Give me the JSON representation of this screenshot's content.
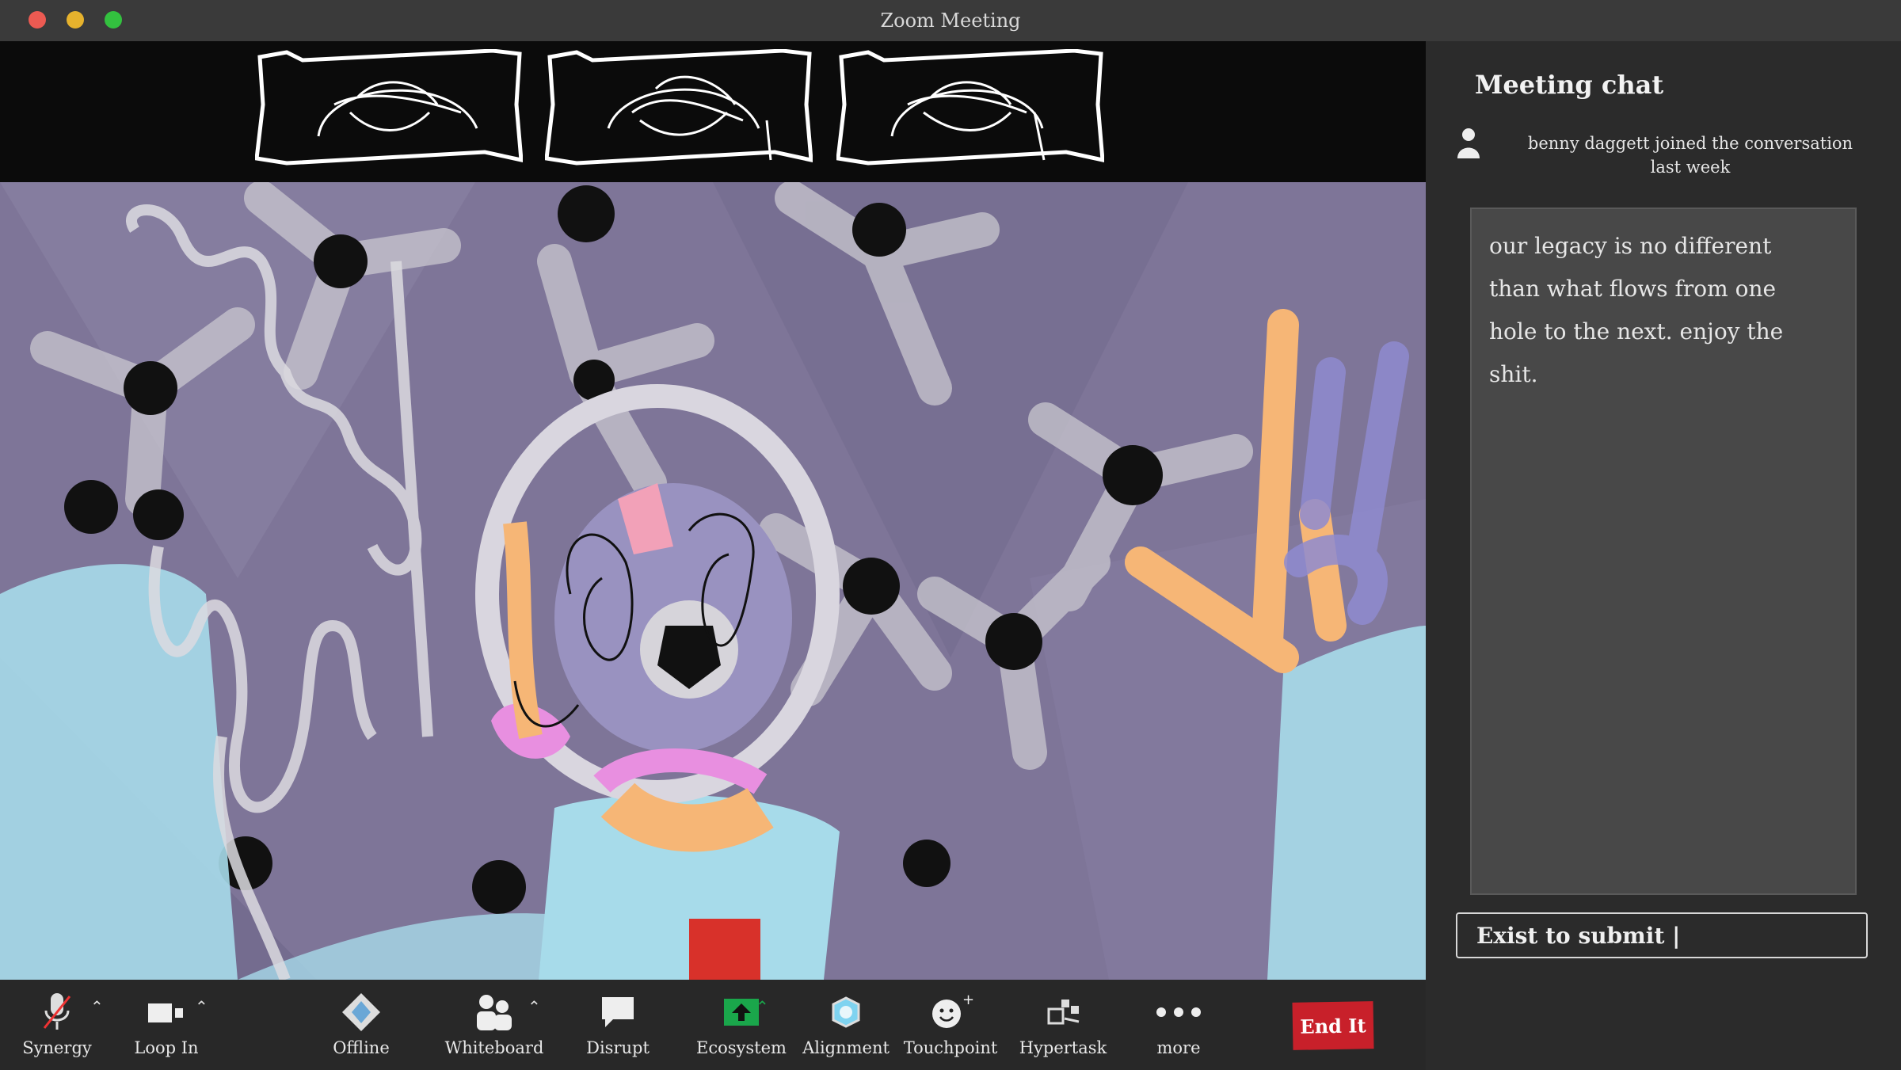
{
  "window": {
    "title": "Zoom Meeting"
  },
  "toolbar": {
    "items": [
      {
        "label": "Synergy",
        "icon": "microphone-muted-icon",
        "has_caret": true
      },
      {
        "label": "Loop In",
        "icon": "video-camera-icon",
        "has_caret": true
      },
      {
        "label": "Offline",
        "icon": "diamond-share-icon",
        "has_caret": false
      },
      {
        "label": "Whiteboard",
        "icon": "participants-icon",
        "has_caret": true
      },
      {
        "label": "Disrupt",
        "icon": "chat-bubble-icon",
        "has_caret": false
      },
      {
        "label": "Ecosystem",
        "icon": "share-screen-icon",
        "has_caret": true
      },
      {
        "label": "Alignment",
        "icon": "record-icon",
        "has_caret": false
      },
      {
        "label": "Touchpoint",
        "icon": "reactions-icon",
        "has_caret": false
      },
      {
        "label": "Hypertask",
        "icon": "apps-icon",
        "has_caret": false
      },
      {
        "label": "more",
        "icon": "more-dots-icon",
        "has_caret": false
      }
    ],
    "end_label": "End It"
  },
  "chat": {
    "title": "Meeting chat",
    "join_line1": "benny daggett  joined the conversation",
    "join_line2": "last week",
    "message_lines": [
      "our legacy is no different",
      "than what flows from one",
      "hole to the next. enjoy the",
      "shit."
    ],
    "input_value": "Exist to submit |"
  },
  "colors": {
    "accent_green": "#1aa64b",
    "end_red": "#c8202a",
    "video_bg": "#7e7598"
  }
}
